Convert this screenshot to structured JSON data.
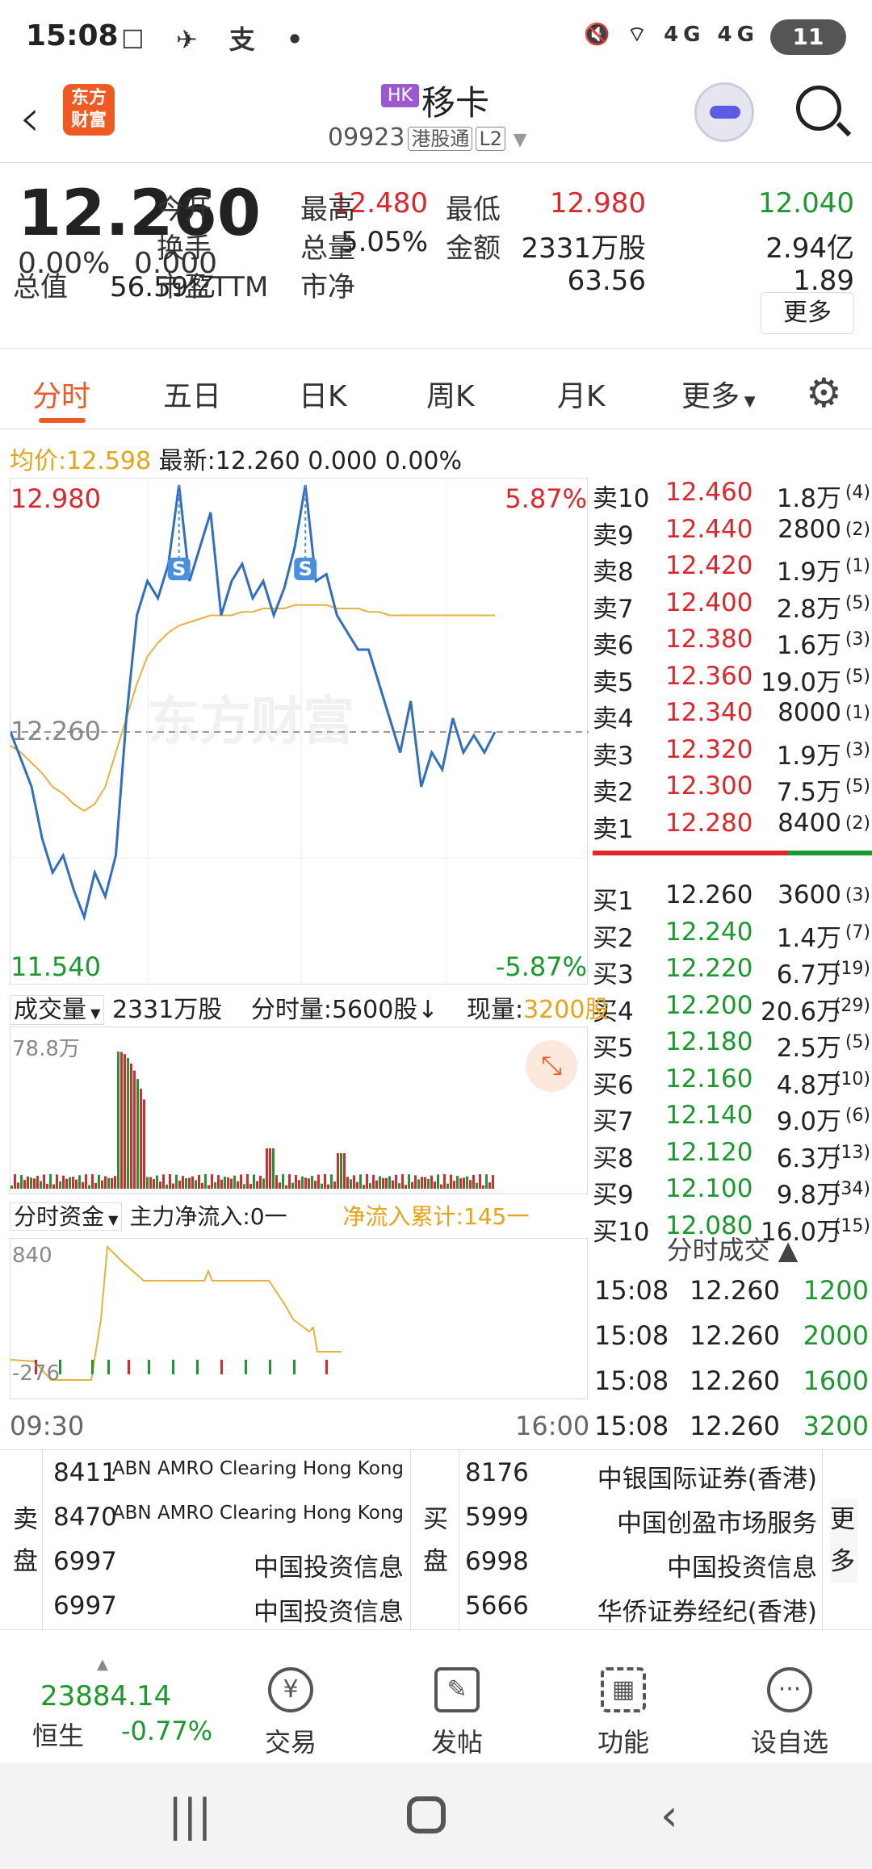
{
  "status_bar": {
    "time": "15:08",
    "left_icons": "☐ ✈ 支 •",
    "right_icons": "🔇 ⌔ 4G 4G",
    "battery": "11"
  },
  "header": {
    "logo": "东方财富",
    "market_tag": "HK",
    "stock_name": "移卡",
    "stock_code": "09923",
    "badge_connect": "港股通",
    "badge_level": "L2"
  },
  "quote": {
    "price": "12.260",
    "change_pct": "0.00%",
    "change": "0.000",
    "fields": [
      {
        "label": "今开",
        "value": "12.480",
        "color": "red"
      },
      {
        "label": "最高",
        "value": "12.980",
        "color": "red"
      },
      {
        "label": "最低",
        "value": "12.040",
        "color": "green"
      },
      {
        "label": "换手",
        "value": "5.05%",
        "color": "black"
      },
      {
        "label": "总量",
        "value": "2331万股",
        "color": "black"
      },
      {
        "label": "金额",
        "value": "2.94亿",
        "color": "black"
      },
      {
        "label": "总值",
        "value": "56.59亿",
        "color": "black"
      },
      {
        "label": "市盈TTM",
        "value": "63.56",
        "color": "black"
      },
      {
        "label": "市净",
        "value": "1.89",
        "color": "black"
      }
    ],
    "more_label": "更多"
  },
  "tabs": [
    "分时",
    "五日",
    "日K",
    "周K",
    "月K",
    "更多"
  ],
  "intraday": {
    "avg_label": "均价:",
    "avg_value": "12.598",
    "latest_label": "最新:",
    "latest_value": "12.260",
    "latest_change": "0.000",
    "latest_pct": "0.00%",
    "high_price": "12.980",
    "low_price": "11.540",
    "high_pct": "5.87%",
    "low_pct": "-5.87%",
    "ref_price": "12.260",
    "watermark": "东方财富",
    "price_series": [
      12.26,
      12.18,
      12.1,
      11.95,
      11.85,
      11.9,
      11.8,
      11.72,
      11.85,
      11.78,
      11.9,
      12.3,
      12.6,
      12.7,
      12.65,
      12.75,
      12.98,
      12.7,
      12.8,
      12.9,
      12.6,
      12.7,
      12.75,
      12.65,
      12.7,
      12.6,
      12.68,
      12.8,
      12.98,
      12.7,
      12.72,
      12.6,
      12.55,
      12.5,
      12.5,
      12.4,
      12.3,
      12.2,
      12.35,
      12.1,
      12.2,
      12.15,
      12.3,
      12.2,
      12.25,
      12.2,
      12.26
    ],
    "avg_series": [
      12.22,
      12.2,
      12.17,
      12.14,
      12.1,
      12.08,
      12.05,
      12.03,
      12.05,
      12.1,
      12.2,
      12.3,
      12.4,
      12.48,
      12.52,
      12.55,
      12.57,
      12.58,
      12.59,
      12.6,
      12.6,
      12.6,
      12.61,
      12.61,
      12.62,
      12.62,
      12.62,
      12.63,
      12.63,
      12.63,
      12.63,
      12.62,
      12.62,
      12.62,
      12.61,
      12.61,
      12.6,
      12.6,
      12.6,
      12.6,
      12.6,
      12.6,
      12.6,
      12.6,
      12.6,
      12.6,
      12.6
    ]
  },
  "order_book": {
    "asks": [
      {
        "label": "卖10",
        "price": "12.460",
        "volume": "1.8万",
        "count": "(4)"
      },
      {
        "label": "卖9",
        "price": "12.440",
        "volume": "2800",
        "count": "(2)"
      },
      {
        "label": "卖8",
        "price": "12.420",
        "volume": "1.9万",
        "count": "(1)"
      },
      {
        "label": "卖7",
        "price": "12.400",
        "volume": "2.8万",
        "count": "(5)"
      },
      {
        "label": "卖6",
        "price": "12.380",
        "volume": "1.6万",
        "count": "(3)"
      },
      {
        "label": "卖5",
        "price": "12.360",
        "volume": "19.0万",
        "count": "(5)"
      },
      {
        "label": "卖4",
        "price": "12.340",
        "volume": "8000",
        "count": "(1)"
      },
      {
        "label": "卖3",
        "price": "12.320",
        "volume": "1.9万",
        "count": "(3)"
      },
      {
        "label": "卖2",
        "price": "12.300",
        "volume": "7.5万",
        "count": "(5)"
      },
      {
        "label": "卖1",
        "price": "12.280",
        "volume": "8400",
        "count": "(2)"
      }
    ],
    "bids": [
      {
        "label": "买1",
        "price": "12.260",
        "volume": "3600",
        "count": "(3)"
      },
      {
        "label": "买2",
        "price": "12.240",
        "volume": "1.4万",
        "count": "(7)"
      },
      {
        "label": "买3",
        "price": "12.220",
        "volume": "6.7万",
        "count": "(19)"
      },
      {
        "label": "买4",
        "price": "12.200",
        "volume": "20.6万",
        "count": "(29)"
      },
      {
        "label": "买5",
        "price": "12.180",
        "volume": "2.5万",
        "count": "(5)"
      },
      {
        "label": "买6",
        "price": "12.160",
        "volume": "4.8万",
        "count": "(10)"
      },
      {
        "label": "买7",
        "price": "12.140",
        "volume": "9.0万",
        "count": "(6)"
      },
      {
        "label": "买8",
        "price": "12.120",
        "volume": "6.3万",
        "count": "(13)"
      },
      {
        "label": "买9",
        "price": "12.100",
        "volume": "9.8万",
        "count": "(34)"
      },
      {
        "label": "买10",
        "price": "12.080",
        "volume": "16.0万",
        "count": "(15)"
      }
    ]
  },
  "volume": {
    "selector": "成交量",
    "total": "2331万股",
    "tick_label": "分时量:5600股↓",
    "current_label": "现量:",
    "current_value": "3200股",
    "max_label": "78.8万"
  },
  "flow": {
    "selector": "分时资金",
    "main_label": "主力净流入:0一",
    "cum_label": "净流入累计:145一",
    "max_label": "840",
    "min_label": "-276",
    "start_time": "09:30",
    "end_time": "16:00"
  },
  "ticks": {
    "title": "分时成交",
    "rows": [
      {
        "time": "15:08",
        "price": "12.260",
        "vol": "1200"
      },
      {
        "time": "15:08",
        "price": "12.260",
        "vol": "2000"
      },
      {
        "time": "15:08",
        "price": "12.260",
        "vol": "1600"
      },
      {
        "time": "15:08",
        "price": "12.260",
        "vol": "3200"
      }
    ]
  },
  "brokers": {
    "sell_label": "卖盘",
    "buy_label": "买盘",
    "more_label": "更多",
    "sell": [
      {
        "code": "8411",
        "name": "ABN AMRO Clearing Hong Kong"
      },
      {
        "code": "8470",
        "name": "ABN AMRO Clearing Hong Kong"
      },
      {
        "code": "6997",
        "name": "中国投资信息"
      },
      {
        "code": "6997",
        "name": "中国投资信息"
      }
    ],
    "buy": [
      {
        "code": "8176",
        "name": "中银国际证券(香港)"
      },
      {
        "code": "5999",
        "name": "中国创盈市场服务"
      },
      {
        "code": "6998",
        "name": "中国投资信息"
      },
      {
        "code": "5666",
        "name": "华侨证券经纪(香港)"
      }
    ]
  },
  "bottom_bar": {
    "index_value": "23884.14",
    "index_name": "恒生",
    "index_change": "-0.77%",
    "buttons": [
      "交易",
      "发帖",
      "功能",
      "设自选"
    ]
  }
}
